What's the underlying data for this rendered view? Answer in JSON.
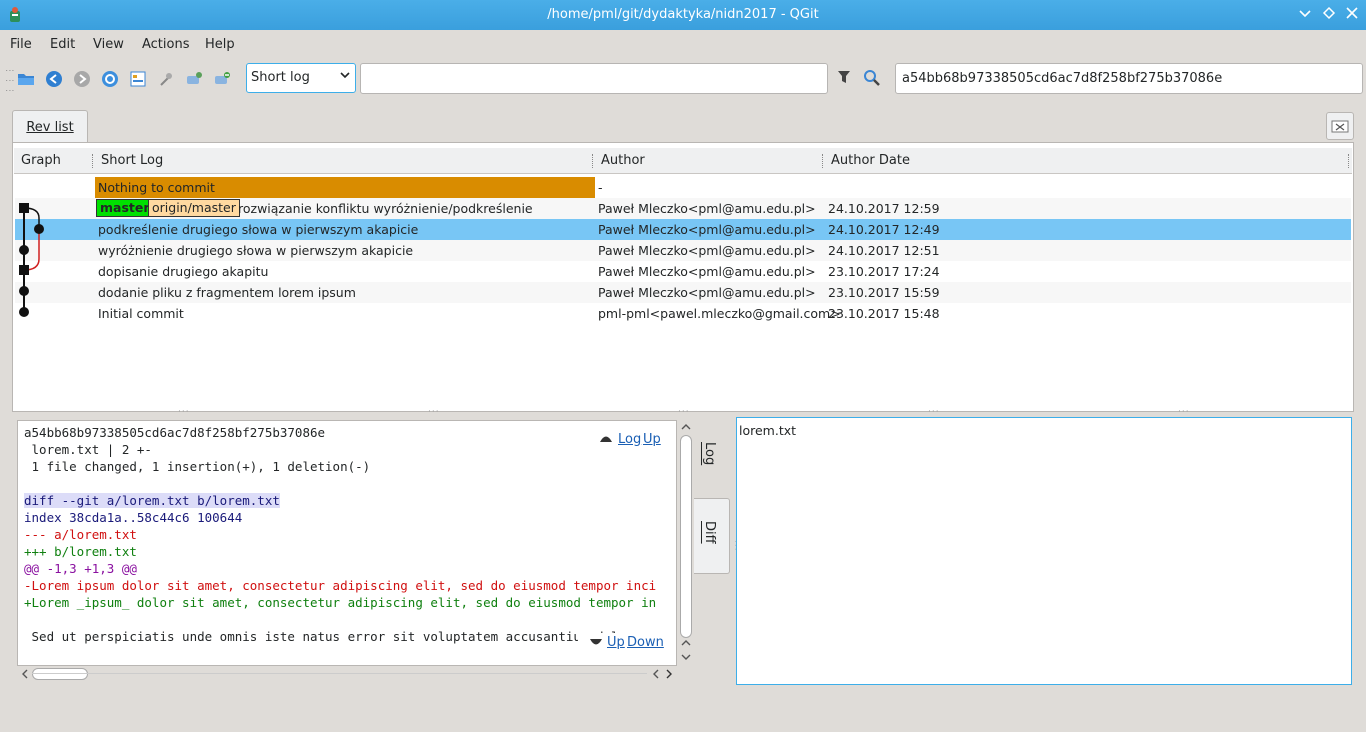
{
  "window": {
    "title": "/home/pml/git/dydaktyka/nidn2017 - QGit"
  },
  "menu": [
    "File",
    "Edit",
    "View",
    "Actions",
    "Help"
  ],
  "toolbar": {
    "mode": "Short log",
    "filter_value": "",
    "sha_value": "a54bb68b97338505cd6ac7d8f258bf275b37086e"
  },
  "tabs": {
    "rev_list": "Rev list"
  },
  "revlist": {
    "headers": {
      "graph": "Graph",
      "short_log": "Short Log",
      "author": "Author",
      "date": "Author Date"
    },
    "working_dir": {
      "text": "Nothing to commit",
      "author": "-"
    },
    "rows": [
      {
        "refs": [
          "master",
          "origin/master"
        ],
        "log": "rozwiązanie konfliktu wyróżnienie/podkreślenie",
        "author": "Paweł Mleczko<pml@amu.edu.pl>",
        "date": "24.10.2017 12:59"
      },
      {
        "refs": [],
        "log": "podkreślenie drugiego słowa w pierwszym akapicie",
        "author": "Paweł Mleczko<pml@amu.edu.pl>",
        "date": "24.10.2017 12:49"
      },
      {
        "refs": [],
        "log": "wyróżnienie drugiego słowa w pierwszym akapicie",
        "author": "Paweł Mleczko<pml@amu.edu.pl>",
        "date": "24.10.2017 12:51"
      },
      {
        "refs": [],
        "log": "dopisanie drugiego akapitu",
        "author": "Paweł Mleczko<pml@amu.edu.pl>",
        "date": "23.10.2017 17:24"
      },
      {
        "refs": [],
        "log": "dodanie pliku z fragmentem lorem ipsum",
        "author": "Paweł Mleczko<pml@amu.edu.pl>",
        "date": "23.10.2017 15:59"
      },
      {
        "refs": [],
        "log": "Initial commit",
        "author": "pml-pml<pawel.mleczko@gmail.com>",
        "date": "23.10.2017 15:48"
      }
    ]
  },
  "diff": {
    "lines": [
      "a54bb68b97338505cd6ac7d8f258bf275b37086e",
      " lorem.txt | 2 +-",
      " 1 file changed, 1 insertion(+), 1 deletion(-)",
      "",
      "diff --git a/lorem.txt b/lorem.txt",
      "index 38cda1a..58c44c6 100644",
      "--- a/lorem.txt",
      "+++ b/lorem.txt",
      "@@ -1,3 +1,3 @@",
      "-Lorem ipsum dolor sit amet, consectetur adipiscing elit, sed do eiusmod tempor inci",
      "+Lorem _ipsum_ dolor sit amet, consectetur adipiscing elit, sed do eiusmod tempor in",
      "",
      " Sed ut perspiciatis unde omnis iste natus error sit voluptatem accusantium dolorem"
    ],
    "nav_top": {
      "log": "Log",
      "up": "Up"
    },
    "nav_bottom": {
      "up": "Up",
      "down": "Down"
    }
  },
  "side_tabs": {
    "log": "Log",
    "diff": "Diff"
  },
  "files": [
    "lorem.txt"
  ]
}
